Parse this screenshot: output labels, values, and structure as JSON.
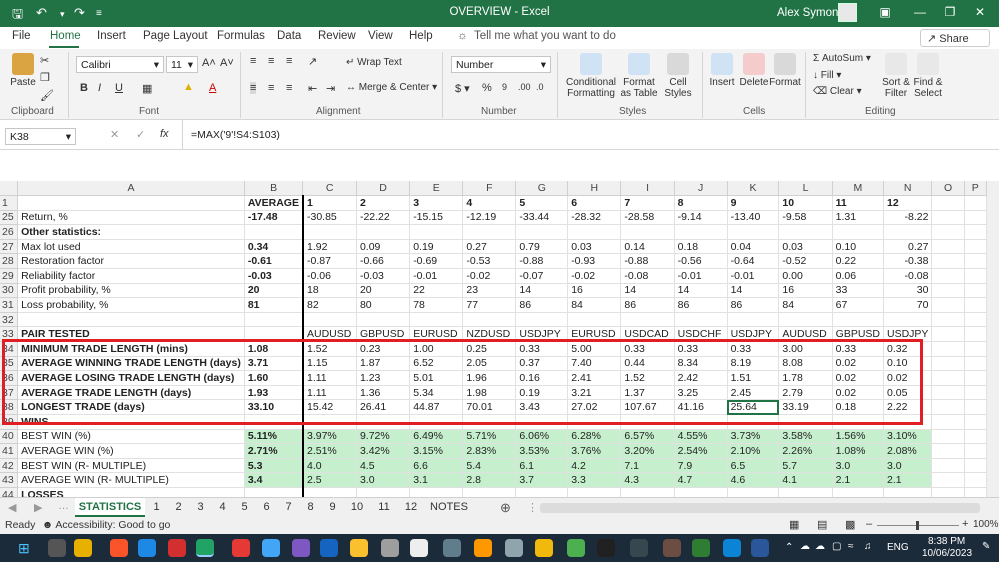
{
  "window": {
    "title": "OVERVIEW - Excel",
    "user": "Alex Symoniv"
  },
  "menu": [
    "File",
    "Home",
    "Insert",
    "Page Layout",
    "Formulas",
    "Data",
    "Review",
    "View",
    "Help"
  ],
  "tellme": "Tell me what you want to do",
  "share": "Share",
  "ribbon": {
    "paste": "Paste",
    "font_name": "Calibri",
    "font_size": "11",
    "wrap_text": "Wrap Text",
    "merge_center": "Merge & Center",
    "number_format": "Number",
    "conditional_formatting": "Conditional Formatting",
    "format_as_table": "Format as Table",
    "cell_styles": "Cell Styles",
    "insert": "Insert",
    "delete": "Delete",
    "format": "Format",
    "autosum": "AutoSum",
    "fill": "Fill",
    "clear": "Clear",
    "sort_filter": "Sort & Filter",
    "find_select": "Find & Select",
    "groups": [
      "Clipboard",
      "Font",
      "Alignment",
      "Number",
      "Styles",
      "Cells",
      "Editing"
    ]
  },
  "formula_bar": {
    "name_box": "K38",
    "formula": "=MAX('9'!S4:S103)"
  },
  "columns": [
    "A",
    "B",
    "C",
    "D",
    "E",
    "F",
    "G",
    "H",
    "I",
    "J",
    "K",
    "L",
    "M",
    "N",
    "O",
    "P"
  ],
  "rows": [
    {
      "n": "1",
      "cells": [
        "",
        "AVERAGE",
        "1",
        "2",
        "3",
        "4",
        "5",
        "6",
        "7",
        "8",
        "9",
        "10",
        "11",
        "12",
        "",
        ""
      ]
    },
    {
      "n": "25",
      "cells": [
        "Return, %",
        "-17.48",
        "-30.85",
        "-22.22",
        "-15.15",
        "-12.19",
        "-33.44",
        "-28.32",
        "-28.58",
        "-9.14",
        "-13.40",
        "-9.58",
        "1.31",
        "-8.22",
        "",
        ""
      ]
    },
    {
      "n": "26",
      "cells": [
        "Other statistics:",
        "",
        "",
        "",
        "",
        "",
        "",
        "",
        "",
        "",
        "",
        "",
        "",
        "",
        "",
        ""
      ]
    },
    {
      "n": "27",
      "cells": [
        "Max lot used",
        "0.34",
        "1.92",
        "0.09",
        "0.19",
        "0.27",
        "0.79",
        "0.03",
        "0.14",
        "0.18",
        "0.04",
        "0.03",
        "0.10",
        "0.27",
        "",
        ""
      ]
    },
    {
      "n": "28",
      "cells": [
        "Restoration factor",
        "-0.61",
        "-0.87",
        "-0.66",
        "-0.69",
        "-0.53",
        "-0.88",
        "-0.93",
        "-0.88",
        "-0.56",
        "-0.64",
        "-0.52",
        "0.22",
        "-0.38",
        "",
        ""
      ]
    },
    {
      "n": "29",
      "cells": [
        "Reliability factor",
        "-0.03",
        "-0.06",
        "-0.03",
        "-0.01",
        "-0.02",
        "-0.07",
        "-0.02",
        "-0.08",
        "-0.01",
        "-0.01",
        "0.00",
        "0.06",
        "-0.08",
        "",
        ""
      ]
    },
    {
      "n": "30",
      "cells": [
        "Profit probability, %",
        "20",
        "18",
        "20",
        "22",
        "23",
        "14",
        "16",
        "14",
        "14",
        "14",
        "16",
        "33",
        "30",
        "",
        ""
      ]
    },
    {
      "n": "31",
      "cells": [
        "Loss probability, %",
        "81",
        "82",
        "80",
        "78",
        "77",
        "86",
        "84",
        "86",
        "86",
        "86",
        "84",
        "67",
        "70",
        "",
        ""
      ]
    },
    {
      "n": "32",
      "cells": [
        "",
        "",
        "",
        "",
        "",
        "",
        "",
        "",
        "",
        "",
        "",
        "",
        "",
        "",
        "",
        ""
      ]
    },
    {
      "n": "33",
      "cells": [
        "PAIR TESTED",
        "",
        "AUDUSD",
        "GBPUSD",
        "EURUSD",
        "NZDUSD",
        "USDJPY",
        "EURUSD",
        "USDCAD",
        "USDCHF",
        "USDJPY",
        "AUDUSD",
        "GBPUSD",
        "USDJPY",
        "",
        ""
      ]
    },
    {
      "n": "34",
      "cells": [
        "MINIMUM TRADE LENGTH (mins)",
        "1.08",
        "1.52",
        "0.23",
        "1.00",
        "0.25",
        "0.33",
        "5.00",
        "0.33",
        "0.33",
        "0.33",
        "3.00",
        "0.33",
        "0.32",
        "",
        ""
      ]
    },
    {
      "n": "35",
      "cells": [
        "AVERAGE WINNING TRADE LENGTH (days)",
        "3.71",
        "1.15",
        "1.87",
        "6.52",
        "2.05",
        "0.37",
        "7.40",
        "0.44",
        "8.34",
        "8.19",
        "8.08",
        "0.02",
        "0.10",
        "",
        ""
      ]
    },
    {
      "n": "36",
      "cells": [
        "AVERAGE LOSING TRADE LENGTH (days)",
        "1.60",
        "1.11",
        "1.23",
        "5.01",
        "1.96",
        "0.16",
        "2.41",
        "1.52",
        "2.42",
        "1.51",
        "1.78",
        "0.02",
        "0.02",
        "",
        ""
      ]
    },
    {
      "n": "37",
      "cells": [
        "AVERAGE TRADE LENGTH (days)",
        "1.93",
        "1.11",
        "1.36",
        "5.34",
        "1.98",
        "0.19",
        "3.21",
        "1.37",
        "3.25",
        "2.45",
        "2.79",
        "0.02",
        "0.05",
        "",
        ""
      ]
    },
    {
      "n": "38",
      "cells": [
        "LONGEST TRADE (days)",
        "33.10",
        "15.42",
        "26.41",
        "44.87",
        "70.01",
        "3.43",
        "27.02",
        "107.67",
        "41.16",
        "25.64",
        "33.19",
        "0.18",
        "2.22",
        "",
        ""
      ]
    },
    {
      "n": "39",
      "cells": [
        "WINS",
        "",
        "",
        "",
        "",
        "",
        "",
        "",
        "",
        "",
        "",
        "",
        "",
        "",
        "",
        ""
      ]
    },
    {
      "n": "40",
      "cells": [
        "BEST WIN (%)",
        "5.11%",
        "3.97%",
        "9.72%",
        "6.49%",
        "5.71%",
        "6.06%",
        "6.28%",
        "6.57%",
        "4.55%",
        "3.73%",
        "3.58%",
        "1.56%",
        "3.10%",
        "",
        ""
      ]
    },
    {
      "n": "41",
      "cells": [
        "AVERAGE WIN (%)",
        "2.71%",
        "2.51%",
        "3.42%",
        "3.15%",
        "2.83%",
        "3.53%",
        "3.76%",
        "3.20%",
        "2.54%",
        "2.10%",
        "2.26%",
        "1.08%",
        "2.08%",
        "",
        ""
      ]
    },
    {
      "n": "42",
      "cells": [
        "BEST WIN (R- MULTIPLE)",
        "5.3",
        "4.0",
        "4.5",
        "6.6",
        "5.4",
        "6.1",
        "4.2",
        "7.1",
        "7.9",
        "6.5",
        "5.7",
        "3.0",
        "3.0",
        "",
        ""
      ]
    },
    {
      "n": "43",
      "cells": [
        "AVERAGE WIN (R- MULTIPLE)",
        "3.4",
        "2.5",
        "3.0",
        "3.1",
        "2.8",
        "3.7",
        "3.3",
        "4.3",
        "4.7",
        "4.6",
        "4.1",
        "2.1",
        "2.1",
        "",
        ""
      ]
    },
    {
      "n": "44",
      "cells": [
        "LOSSES",
        "",
        "",
        "",
        "",
        "",
        "",
        "",
        "",
        "",
        "",
        "",
        "",
        "",
        "",
        ""
      ]
    }
  ],
  "sheet_tabs": [
    "STATISTICS",
    "1",
    "2",
    "3",
    "4",
    "5",
    "6",
    "7",
    "8",
    "9",
    "10",
    "11",
    "12",
    "NOTES"
  ],
  "status": {
    "ready": "Ready",
    "accessibility": "Accessibility: Good to go",
    "zoom": "100%"
  },
  "taskbar": {
    "lang": "ENG",
    "time": "8:38 PM",
    "date": "10/06/2023"
  }
}
